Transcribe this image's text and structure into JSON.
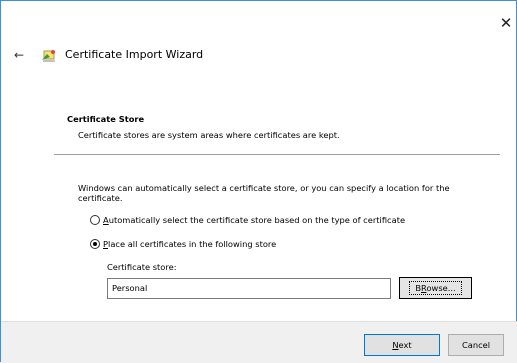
{
  "window": {
    "close_glyph": "✕",
    "back_glyph": "←",
    "title": "Certificate Import Wizard",
    "title_icon": "certificate-wizard-icon"
  },
  "section": {
    "title": "Certificate Store",
    "description": "Certificate stores are system areas where certificates are kept."
  },
  "info": {
    "text": "Windows can automatically select a certificate store, or you can specify a location for the certificate."
  },
  "options": [
    {
      "prefix": "",
      "accel": "A",
      "rest": "utomatically select the certificate store based on the type of certificate",
      "selected": false
    },
    {
      "prefix": "",
      "accel": "P",
      "rest": "lace all certificates in the following store",
      "selected": true
    }
  ],
  "store": {
    "label": "Certificate store:",
    "value": "Personal",
    "browse_accel": "R",
    "browse_prefix": "B",
    "browse_rest": "owse..."
  },
  "footer": {
    "next_accel": "N",
    "next_rest": "ext",
    "cancel_label": "Cancel"
  },
  "colors": {
    "accent": "#0078d7",
    "window_border": "#3c8fd8",
    "footer_bg": "#f0f0f0"
  }
}
